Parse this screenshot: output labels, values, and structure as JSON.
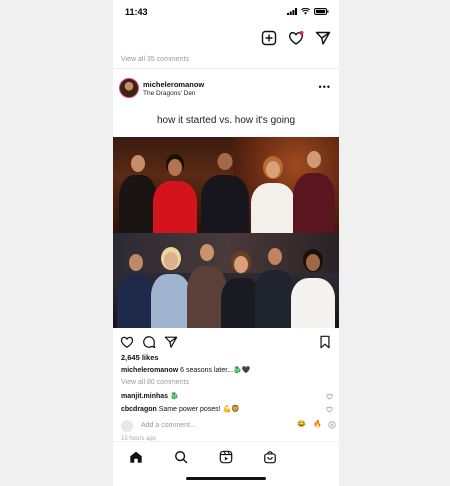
{
  "status": {
    "time": "11:43"
  },
  "feed": {
    "prev_comments": "View all 35 comments"
  },
  "post": {
    "username": "micheleromanow",
    "location": "The Dragons' Den",
    "title_text": "how it started vs. how it's going",
    "likes": "2,645 likes",
    "caption_user": "micheleromanow",
    "caption_text": " 6 seasons later...🐉🖤",
    "view_all_comments": "View all 80 comments",
    "comments": [
      {
        "user": "manjit.minhas",
        "text": " 🐉"
      },
      {
        "user": "cbcdragon",
        "text": " Same power poses! 💪🦁"
      }
    ],
    "add_comment_placeholder": "Add a comment...",
    "quick_emojis": [
      "😂",
      "🔥"
    ],
    "timestamp": "15 hours ago"
  },
  "colors": {
    "accent": "#e0457b",
    "text": "#111111",
    "muted": "#999999"
  }
}
